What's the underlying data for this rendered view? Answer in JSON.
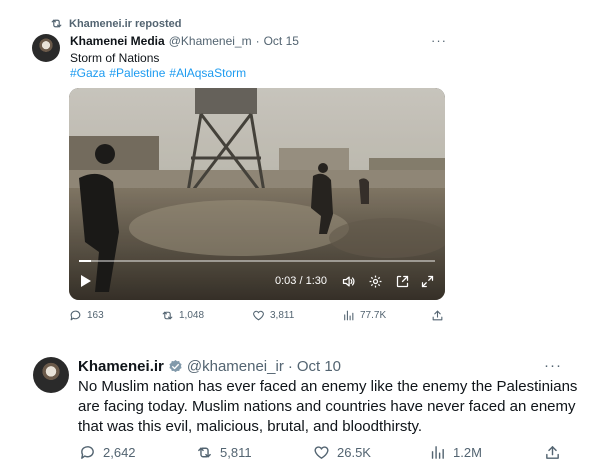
{
  "retweet_banner": {
    "label": "Khamenei.ir reposted",
    "icon": "repost-icon"
  },
  "tweet1": {
    "name": "Khamenei Media",
    "handle": "@Khamenei_m",
    "dot": "·",
    "date": "Oct 15",
    "more": "···",
    "text": "Storm of Nations",
    "hashtags": [
      "#Gaza",
      "#Palestine",
      "#AlAqsaStorm"
    ],
    "video": {
      "time": "0:03 / 1:30",
      "progress": 0.033,
      "controls": [
        "play-icon",
        "volume-icon",
        "settings-icon",
        "popout-icon",
        "fullscreen-icon"
      ]
    },
    "actions": {
      "replies": "163",
      "reposts": "1,048",
      "likes": "3,811",
      "views": "77.7K"
    }
  },
  "tweet2": {
    "name": "Khamenei.ir",
    "handle": "@khamenei_ir",
    "dot": "·",
    "date": "Oct 10",
    "more": "···",
    "verified_color": "#829aab",
    "text": "No Muslim nation has ever faced an enemy like the enemy the Palestinians are facing today. Muslim nations and countries have never faced an enemy that was this evil, malicious, brutal, and bloodthirsty.",
    "actions": {
      "replies": "2,642",
      "reposts": "5,811",
      "likes": "26.5K",
      "views": "1.2M"
    }
  },
  "colors": {
    "text_primary": "#0f1419",
    "text_secondary": "#536471",
    "link": "#1d9bf0"
  }
}
